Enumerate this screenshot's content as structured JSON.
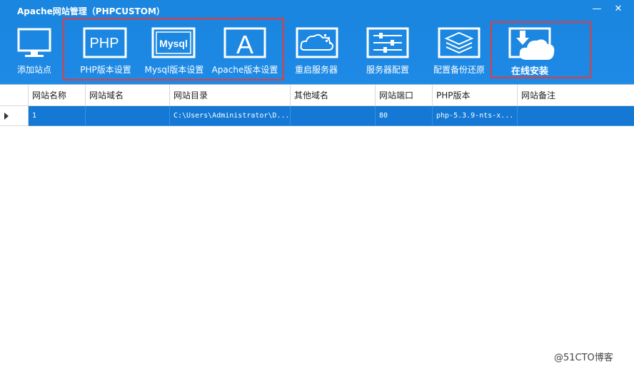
{
  "window": {
    "title": "Apache网站管理（PHPCUSTOM）",
    "minimize_glyph": "—",
    "close_glyph": "✕"
  },
  "toolbar": {
    "add_site": "添加站点",
    "php_version": "PHP版本设置",
    "mysql_version": "Mysql版本设置",
    "apache_version": "Apache版本设置",
    "restart_server": "重启服务器",
    "server_config": "服务器配置",
    "config_backup": "配置备份还原",
    "online_install": "在线安装",
    "php_icon_text": "PHP",
    "mysql_icon_text": "Mysql",
    "apache_icon_text": "A"
  },
  "table": {
    "columns": [
      "网站名称",
      "网站域名",
      "网站目录",
      "其他域名",
      "网站端口",
      "PHP版本",
      "网站备注"
    ],
    "rows": [
      {
        "name": "1",
        "domain": "",
        "directory": "C:\\Users\\Administrator\\D...",
        "other_domain": "",
        "port": "80",
        "php_version": "php-5.3.9-nts-x...",
        "remark": ""
      }
    ]
  },
  "watermark": "@51CTO博客",
  "colors": {
    "titlebar": "#1a86e0",
    "selected_row": "#1478d4",
    "highlight": "#e23c3c"
  }
}
